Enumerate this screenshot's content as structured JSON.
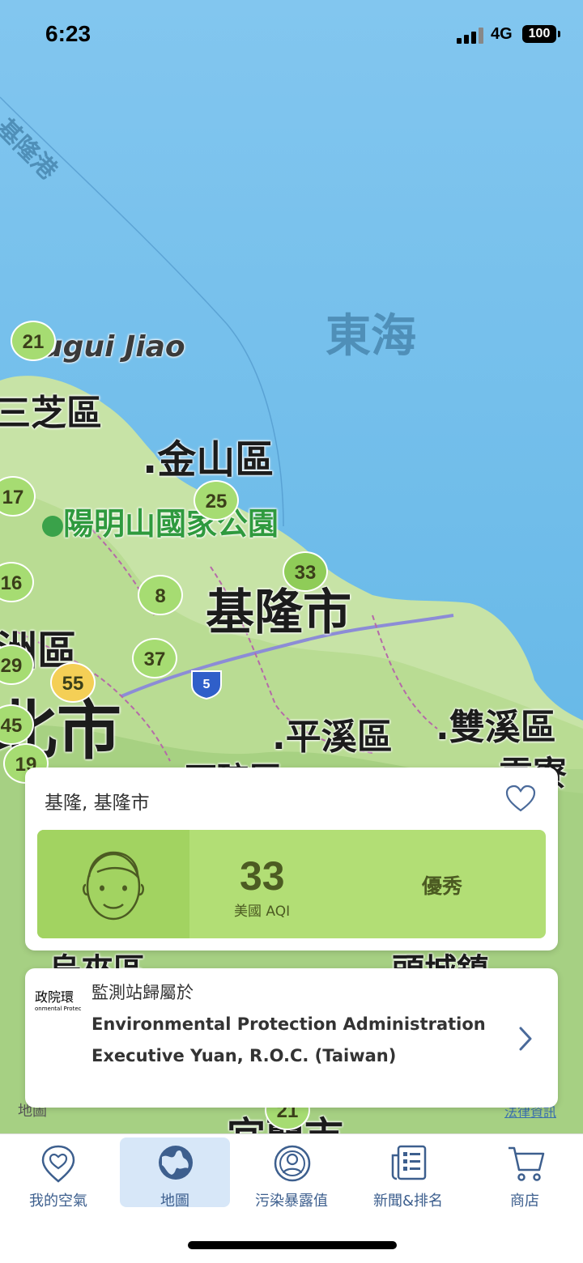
{
  "status_bar": {
    "time": "6:23",
    "network": "4G",
    "battery": "100"
  },
  "map": {
    "labels": {
      "sea": "東海",
      "port": "基隆港",
      "cape": "ugui Jiao",
      "sanzhi": "三芝區",
      "jinshan": ".金山區",
      "park": "陽明山國家公園",
      "keelung": "基隆市",
      "luzhou": "洲區",
      "taipei": "北市",
      "pingxi": ".平溪區",
      "shuangxi": ".雙溪區",
      "gongliao": ".貢寮",
      "shiding": "石碇區",
      "lower1": "烏來區",
      "lower2": "頭城鎮",
      "yilan": "宜蘭市"
    },
    "highway": "5",
    "aqi_pins": [
      "21",
      "17",
      "25",
      "33",
      "16",
      "8",
      "29",
      "55",
      "37",
      "45",
      "19",
      "21"
    ],
    "colors": {
      "good": "#a6dc72",
      "moderate": "#f4cf56"
    }
  },
  "station_card": {
    "title": "基隆, 基隆市",
    "favorite_icon": "heart-icon",
    "aqi_value": "33",
    "aqi_unit": "美國 AQI",
    "aqi_level": "優秀",
    "level_color": "#b2de75"
  },
  "source_card": {
    "heading": "監測站歸屬於",
    "organization": "Environmental Protection Administration Executive Yuan, R.O.C. (Taiwan)",
    "logo_text": "政院環",
    "logo_subtext": "onmental Protec tive Yuan, R.O"
  },
  "map_attribution": "地圖",
  "legal_link": "法律資訊",
  "tabs": [
    {
      "label": "我的空氣",
      "icon": "heart-location-icon"
    },
    {
      "label": "地圖",
      "icon": "globe-icon"
    },
    {
      "label": "污染暴露值",
      "icon": "user-circle-icon"
    },
    {
      "label": "新聞&排名",
      "icon": "newspaper-icon"
    },
    {
      "label": "商店",
      "icon": "cart-icon"
    }
  ]
}
